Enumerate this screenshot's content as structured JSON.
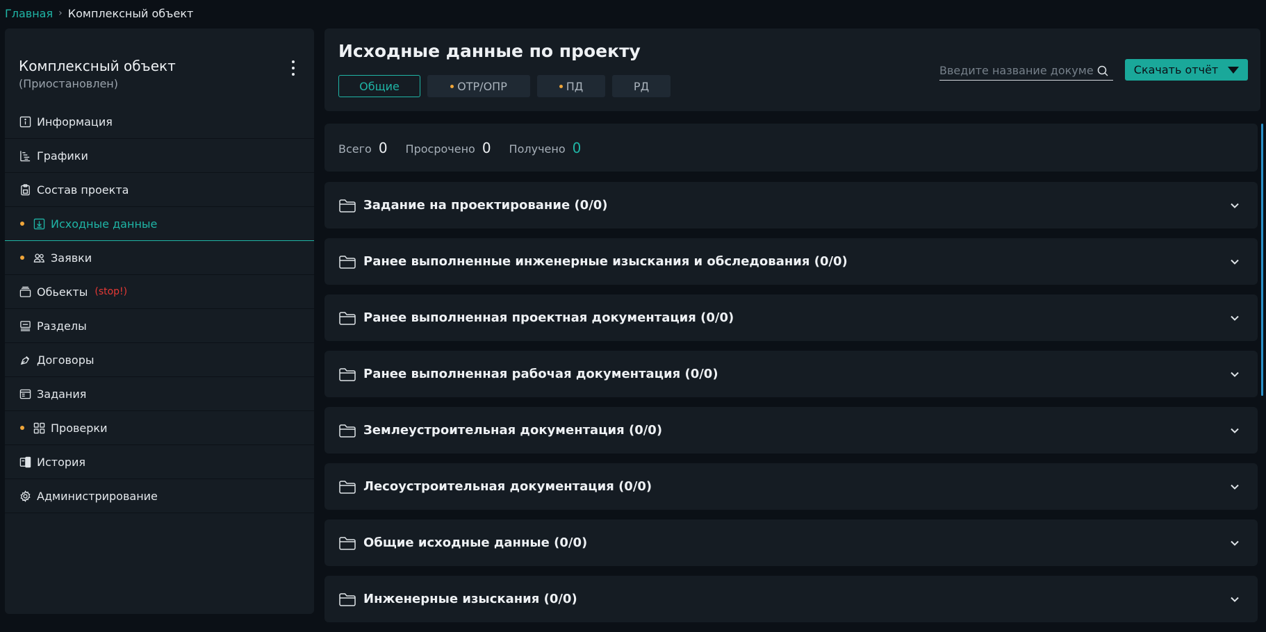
{
  "breadcrumb": {
    "home": "Главная",
    "separator": "›",
    "current": "Комплексный объект"
  },
  "sidebar": {
    "title": "Комплексный объект",
    "subtitle": "(Приостановлен)",
    "items": [
      {
        "label": "Информация",
        "icon": "info-icon",
        "dot": false
      },
      {
        "label": "Графики",
        "icon": "gantt-icon",
        "dot": false
      },
      {
        "label": "Состав проекта",
        "icon": "clipboard-icon",
        "dot": false
      },
      {
        "label": "Исходные данные",
        "icon": "download-box-icon",
        "dot": true,
        "active": true
      },
      {
        "label": "Заявки",
        "icon": "users-icon",
        "dot": true
      },
      {
        "label": "Обьекты",
        "icon": "objects-icon",
        "dot": false,
        "tag": "(stop!)"
      },
      {
        "label": "Разделы",
        "icon": "sections-icon",
        "dot": false
      },
      {
        "label": "Договоры",
        "icon": "pen-icon",
        "dot": false
      },
      {
        "label": "Задания",
        "icon": "tasks-icon",
        "dot": false
      },
      {
        "label": "Проверки",
        "icon": "grid-icon",
        "dot": true
      },
      {
        "label": "История",
        "icon": "history-icon",
        "dot": false
      },
      {
        "label": "Администрирование",
        "icon": "gear-icon",
        "dot": false
      }
    ]
  },
  "header": {
    "title": "Исходные данные по проекту",
    "tabs": [
      {
        "label": "Общие",
        "active": true,
        "dot": false
      },
      {
        "label": "ОТР/ОПР",
        "active": false,
        "dot": true
      },
      {
        "label": "ПД",
        "active": false,
        "dot": true
      },
      {
        "label": "РД",
        "active": false,
        "dot": false
      }
    ],
    "search_placeholder": "Введите название документа",
    "download_label": "Скачать отчёт"
  },
  "stats": [
    {
      "label": "Всего",
      "value": "0"
    },
    {
      "label": "Просрочено",
      "value": "0"
    },
    {
      "label": "Получено",
      "value": "0"
    }
  ],
  "sections": [
    "Задание на проектирование (0/0)",
    "Ранее выполненные инженерные изыскания и обследования (0/0)",
    "Ранее выполненная проектная документация (0/0)",
    "Ранее выполненная рабочая документация (0/0)",
    "Землеустроительная документация (0/0)",
    "Лесоустроительная документация (0/0)",
    "Общие исходные данные (0/0)",
    "Инженерные изыскания (0/0)"
  ],
  "colors": {
    "accent": "#1fb5a6",
    "dot": "#f0a63a",
    "danger": "#e53935",
    "panel": "#151c23",
    "background": "#0b1016"
  }
}
